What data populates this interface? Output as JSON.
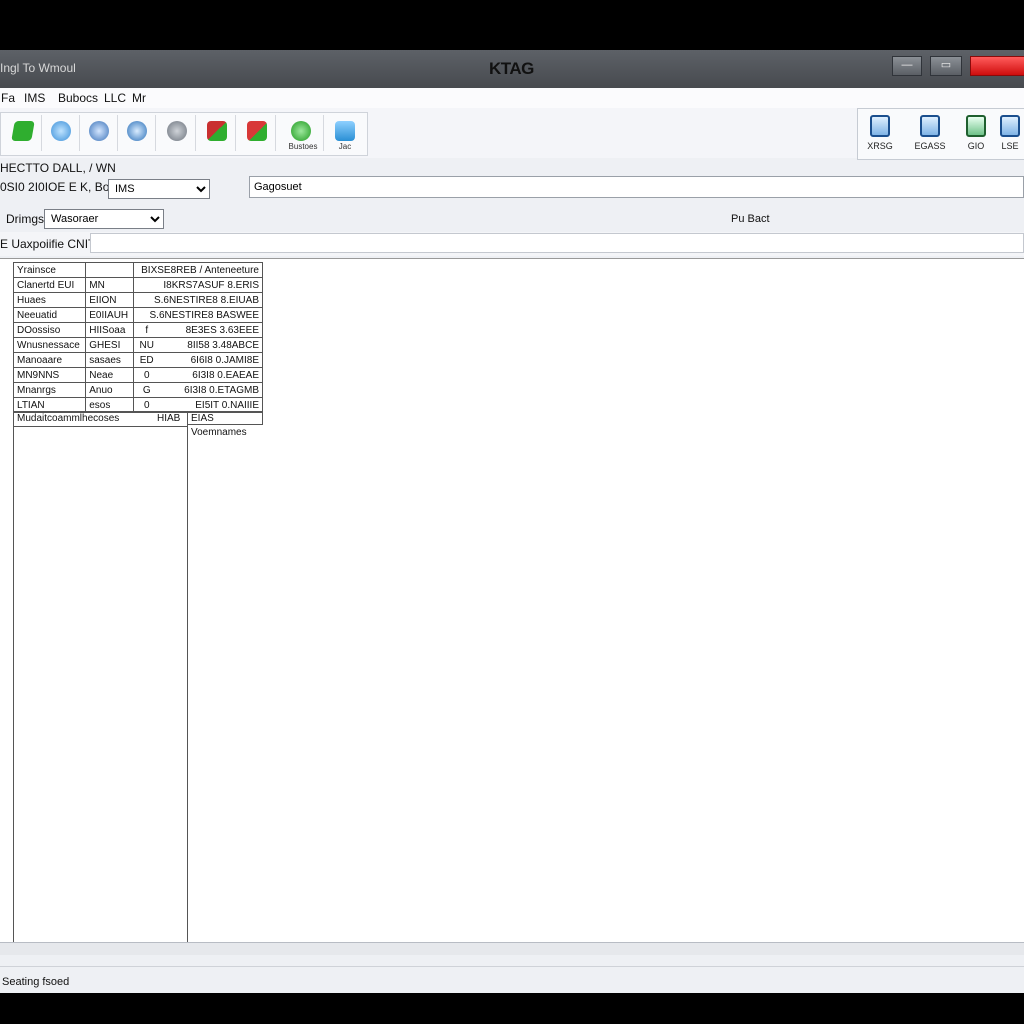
{
  "window": {
    "title_left": "Ingl To Wmoul",
    "title": "KTAG",
    "controls": {
      "minimize": "—",
      "maximize": "▭",
      "close": ""
    }
  },
  "menu": [
    "Fa",
    "IMS",
    "Bubocs",
    "LLC",
    "Mr"
  ],
  "toolbar": {
    "buttons": [
      {
        "icon": "connect-icon",
        "label": "",
        "color": "#2fae2f"
      },
      {
        "icon": "disk-icon",
        "label": "",
        "color": "#3a8fd8"
      },
      {
        "icon": "chip-icon",
        "label": "",
        "color": "#3a72b8"
      },
      {
        "icon": "settings-icon",
        "label": "",
        "color": "#6c737d"
      },
      {
        "icon": "flag-icon",
        "label": "",
        "color": "#c93030"
      },
      {
        "icon": "map-icon",
        "label": "",
        "color": "#d83838"
      },
      {
        "icon": "power-icon",
        "label": "Bustoes",
        "color": "#2fae2f"
      },
      {
        "icon": "info-icon",
        "label": "Jac",
        "color": "#2a8fd4"
      }
    ],
    "right_buttons": [
      {
        "icon": "monitor-icon",
        "label": "XRSG"
      },
      {
        "icon": "save-icon",
        "label": "EGASS"
      },
      {
        "icon": "battery-icon",
        "label": "GIO"
      },
      {
        "icon": "network-icon",
        "label": "LSE"
      }
    ]
  },
  "form": {
    "row1_label": "HECTTO DALL, / WN",
    "row2_label": "0SI0 2I0IOE E K, Boy",
    "row2_select": "IMS",
    "row2_field": "Gagosuet",
    "row3_label": "Drimgs",
    "row3_select": "Wasoraer",
    "row3_right_label": "Pu Bact",
    "row4_label": "E Uaxpoiifie CNIT"
  },
  "info_table": {
    "header": [
      "Yrainsce",
      "",
      "BIXSE8REB / Anteneeture"
    ],
    "rows": [
      [
        "Clanertd EUI",
        "MN",
        "I8KRS7ASUF 8.ERIS"
      ],
      [
        "Huaes",
        "EIION",
        "S.6NESTIRE8 8.EIUAB"
      ],
      [
        "Neeuatid",
        "E0IIAUH",
        "S.6NESTIRE8 BASWEE"
      ],
      [
        "DOossiso",
        "HIISoaa",
        "f",
        "8E3ES 3.63EEE"
      ],
      [
        "Wnusnessace",
        "GHESI",
        "NU",
        "8II58 3.48ABCE"
      ],
      [
        "Manoaare",
        "sasaes",
        "ED",
        "6I6I8 0.JAMI8E"
      ],
      [
        "MN9NNS",
        "Neae",
        "0",
        "6I3I8 0.EAEAE"
      ],
      [
        "Mnanrgs",
        "Anuo",
        "G",
        "6I3I8 0.ETAGMB"
      ],
      [
        "LTIAN",
        "esos",
        "0",
        "EI5IT 0.NAIIIE"
      ]
    ]
  },
  "panes": {
    "left_header": "Mudaitcoammlhecoses",
    "left_header_num": "HIAB",
    "right_header": "EIAS Voemnames"
  },
  "status": "Seating fsoed"
}
